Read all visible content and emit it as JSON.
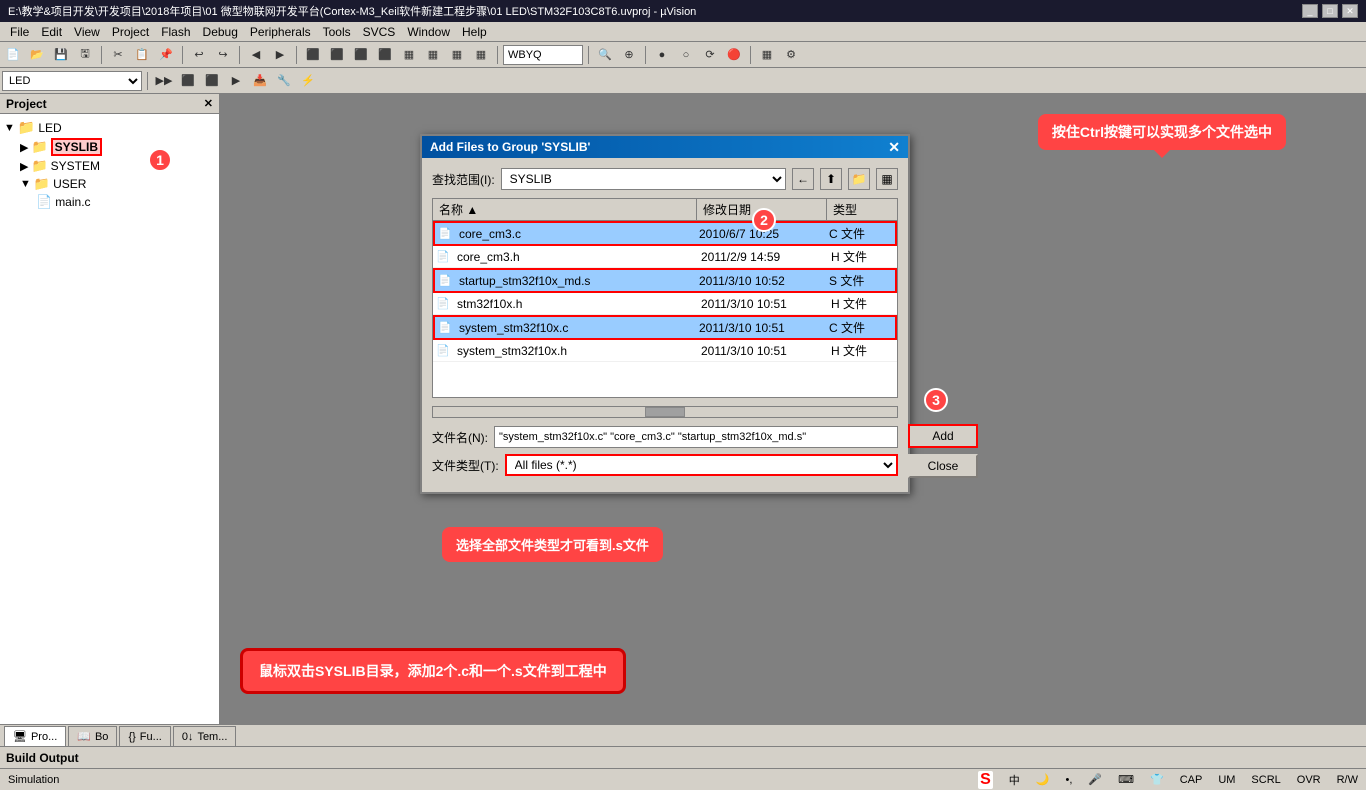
{
  "titleBar": {
    "text": "E:\\教学&项目开发\\开发项目\\2018年项目\\01 微型物联网开发平台(Cortex-M3_Keil软件新建工程步骤\\01 LED\\STM32F103C8T6.uvproj - µVision",
    "controls": [
      "_",
      "□",
      "✕"
    ]
  },
  "menuBar": {
    "items": [
      "File",
      "Edit",
      "View",
      "Project",
      "Flash",
      "Debug",
      "Peripherals",
      "Tools",
      "SVCS",
      "Window",
      "Help"
    ]
  },
  "toolbar": {
    "items": [
      "new",
      "open",
      "close",
      "save",
      "|",
      "cut",
      "copy",
      "paste",
      "|",
      "undo",
      "redo",
      "|",
      "back",
      "forward",
      "|",
      "tb1",
      "tb2",
      "tb3",
      "tb4",
      "tb5",
      "tb6",
      "tb7",
      "tb8",
      "|",
      "WBYQ",
      "|",
      "tb9",
      "tb10",
      "tb11",
      "|",
      "tb12",
      "tb13",
      "tb14",
      "tb15",
      "|",
      "tb16",
      "tb17"
    ]
  },
  "toolbar2": {
    "label": "LED",
    "items": [
      "tb21",
      "tb22",
      "tb23",
      "tb24",
      "tb25",
      "tb26",
      "tb27",
      "tb28",
      "tb29",
      "tb30"
    ]
  },
  "projectPanel": {
    "title": "Project",
    "tree": [
      {
        "level": 0,
        "icon": "📁",
        "label": "LED",
        "expanded": true
      },
      {
        "level": 1,
        "icon": "📁",
        "label": "SYSLIB",
        "highlighted": true
      },
      {
        "level": 1,
        "icon": "📁",
        "label": "SYSTEM"
      },
      {
        "level": 1,
        "icon": "📁",
        "label": "USER",
        "expanded": true
      },
      {
        "level": 2,
        "icon": "📄",
        "label": "main.c"
      }
    ]
  },
  "dialog": {
    "title": "Add Files to Group 'SYSLIB'",
    "lookInLabel": "查找范围(I):",
    "lookInValue": "SYSLIB",
    "fileListHeaders": [
      "名称",
      "修改日期",
      "类型"
    ],
    "files": [
      {
        "name": "core_cm3.c",
        "date": "2010/6/7 10:25",
        "type": "C 文件",
        "highlighted": true
      },
      {
        "name": "core_cm3.h",
        "date": "2011/2/9 14:59",
        "type": "H 文件"
      },
      {
        "name": "startup_stm32f10x_md.s",
        "date": "2011/3/10 10:52",
        "type": "S 文件",
        "highlighted": true
      },
      {
        "name": "stm32f10x.h",
        "date": "2011/3/10 10:51",
        "type": "H 文件"
      },
      {
        "name": "system_stm32f10x.c",
        "date": "2011/3/10 10:51",
        "type": "C 文件",
        "highlighted": true
      },
      {
        "name": "system_stm32f10x.h",
        "date": "2011/3/10 10:51",
        "type": "H 文件"
      }
    ],
    "fileNameLabel": "文件名(N):",
    "fileNameValue": "\"system_stm32f10x.c\" \"core_cm3.c\" \"startup_stm",
    "fileTypeLabel": "文件类型(T):",
    "fileTypeValue": "All files (*.*)",
    "addButton": "Add",
    "closeButton": "Close"
  },
  "annotations": {
    "bubble1": "1",
    "bubble2": "2",
    "bubble3": "3",
    "callout1": "按住Ctrl按键可以实现多个文件选中",
    "callout2": "选择全部文件类型才可看到.s文件",
    "bottomNote": "鼠标双击SYSLIB目录，添加2个.c和一个.s文件到工程中"
  },
  "bottomTabs": [
    {
      "icon": "🖥",
      "label": "Pro..."
    },
    {
      "icon": "📖",
      "label": "Bo"
    },
    {
      "icon": "{}",
      "label": "Fu..."
    },
    {
      "icon": "0",
      "label": "Tem..."
    }
  ],
  "buildOutput": "Build Output",
  "statusBar": {
    "left": "Simulation",
    "indicators": [
      "CAP",
      "UM",
      "SCRL",
      "OVR",
      "R/W"
    ]
  }
}
